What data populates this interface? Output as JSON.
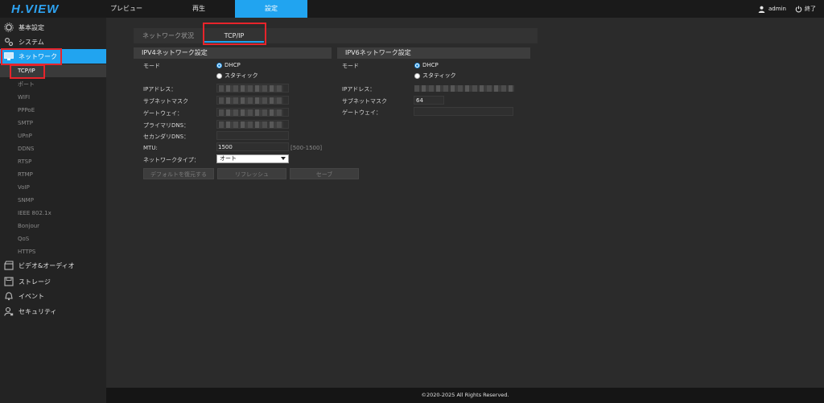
{
  "app": {
    "logo": "H.VIEW"
  },
  "topnav": {
    "items": [
      {
        "label": "プレビュー",
        "active": false
      },
      {
        "label": "再生",
        "active": false
      },
      {
        "label": "設定",
        "active": true
      }
    ],
    "user": "admin",
    "logout": "終了"
  },
  "sidebar": {
    "basic": "基本設定",
    "system": "システム",
    "network": "ネットワーク",
    "subitems": [
      "TCP/IP",
      "ポート",
      "WIFI",
      "PPPoE",
      "SMTP",
      "UPnP",
      "DDNS",
      "RTSP",
      "RTMP",
      "VoIP",
      "SNMP",
      "IEEE 802.1x",
      "Bonjour",
      "QoS",
      "HTTPS"
    ],
    "video_audio": "ビデオ&オーディオ",
    "storage": "ストレージ",
    "event": "イベント",
    "security": "セキュリティ"
  },
  "tabs": [
    {
      "label": "ネットワーク状況",
      "active": false
    },
    {
      "label": "TCP/IP",
      "active": true
    }
  ],
  "ipv4": {
    "title": "IPV4ネットワーク設定",
    "mode_label": "モード",
    "dhcp": "DHCP",
    "static": "スタティック",
    "ip_label": "IPアドレス：",
    "subnet_label": "サブネットマスク",
    "gateway_label": "ゲートウェイ：",
    "dns1_label": "プライマリDNS：",
    "dns2_label": "セカンダリDNS：",
    "mtu_label": "MTU:",
    "mtu_value": "1500",
    "mtu_range": "[500-1500]",
    "nettype_label": "ネットワークタイプ：",
    "nettype_value": "オート"
  },
  "ipv6": {
    "title": "IPV6ネットワーク設定",
    "mode_label": "モード",
    "dhcp": "DHCP",
    "static": "スタティック",
    "ip_label": "IPアドレス：",
    "subnet_label": "サブネットマスク",
    "subnet_value": "64",
    "gateway_label": "ゲートウェイ："
  },
  "buttons": {
    "default": "デフォルトを復元する",
    "refresh": "リフレッシュ",
    "save": "セーブ"
  },
  "footer": "©2020-2025 All Rights Reserved.",
  "colors": {
    "accent": "#21a4f0",
    "highlight_box": "#e8242b"
  }
}
